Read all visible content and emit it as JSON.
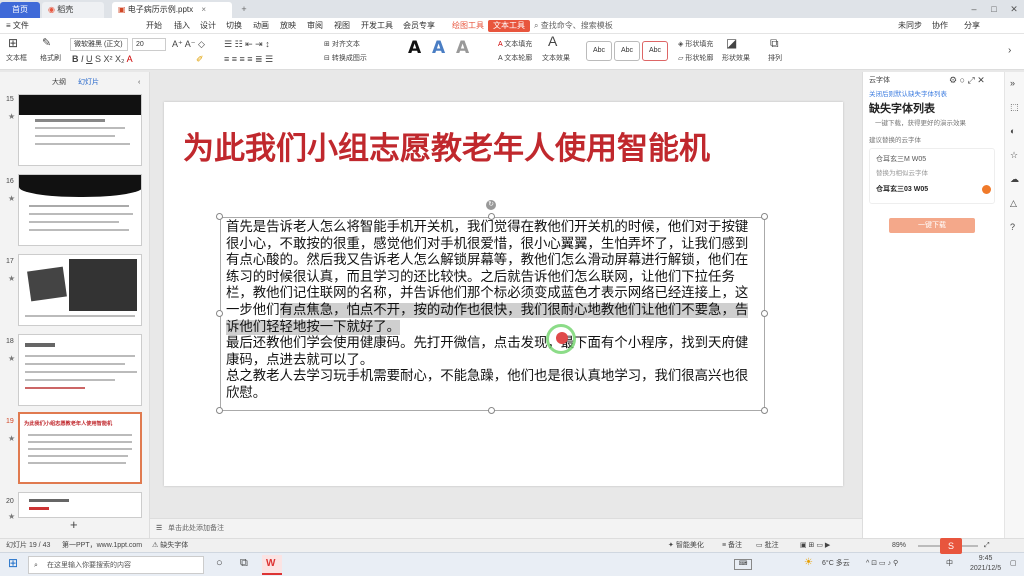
{
  "titlebar": {
    "tabs": [
      "首页",
      "稻壳",
      "电子病历示例.pptx"
    ]
  },
  "menu": {
    "items": [
      "文件",
      "开始",
      "插入",
      "设计",
      "切换",
      "动画",
      "放映",
      "审阅",
      "视图",
      "开发工具",
      "会员专享",
      "绘图工具",
      "文本工具"
    ],
    "search": "查找命令、搜索模板",
    "right": [
      "未同步",
      "协作",
      "分享"
    ]
  },
  "ribbon": {
    "textbox_label": "文本框",
    "clear_label": "格式刷",
    "font_name": "微软雅黑 (正文)",
    "font_size": "20",
    "align_label": "对齐文本",
    "convert_label": "转换成图示",
    "fill_label": "文本填充",
    "outline_label": "文本轮廓",
    "effect_label": "文本效果",
    "shape_fill": "形状填充",
    "shape_outline": "形状轮廓",
    "shape_effect": "形状效果",
    "style_boxes": [
      "Abc",
      "Abc",
      "Abc"
    ],
    "arrange": "排列"
  },
  "left_panel": {
    "tabs": [
      "大纲",
      "幻灯片"
    ],
    "slides": [
      {
        "num": "15",
        "star": "★"
      },
      {
        "num": "16",
        "star": "★"
      },
      {
        "num": "17",
        "star": "★"
      },
      {
        "num": "18",
        "star": "★"
      },
      {
        "num": "19",
        "star": "★",
        "title": "为此我们小组志愿教老年人使用智能机"
      },
      {
        "num": "20",
        "star": "★"
      }
    ],
    "add": "+"
  },
  "slide": {
    "title": "为此我们小组志愿教老年人使用智能机",
    "body_1": "首先是告诉老人怎么将智能手机开关机，我们觉得在教他们开关机的时候，他们对于按键很小心，不敢按的很重，感觉他们对手机很爱惜，很小心翼翼，生怕弄坏了，让我们感到有点心酸的。然后我又告诉老人怎么解锁屏幕等，教他们怎么滑动屏幕进行解锁，他们在练习的时候很认真，而且学习的还比较快。之后就告诉他们怎么联网，让他们下拉任务栏，教他们记住联网的名称，并告诉他们那个标必须变成蓝色才表示网络已经连接上，这一步他们",
    "body_hl": "有点焦急，怕点不开，按的动作也很快，我们很耐心地教他们让他们不要急，告诉他们轻轻地按一下就好了。",
    "body_2": "最后还教他们学会使用健康码。先打开微信，点击发现，最下面有个小程序，找到天府健康码，点进去就可以了。",
    "body_3": "总之教老人去学习玩手机需要耐心，不能急躁，他们也是很认真地学习，我们很高兴也很欣慰。"
  },
  "notes": {
    "placeholder": "单击此处添加备注"
  },
  "right_panel": {
    "header": "云字体",
    "link": "关闭后则默认缺失字体列表",
    "title": "缺失字体列表",
    "desc": "一键下载，获得更好的演示效果",
    "section": "建议替换的云字体",
    "font_1": "仓耳玄三M W05",
    "font_1_sub": "替换为相似云字体",
    "font_2": "仓耳玄三03 W05",
    "download": "一键下载"
  },
  "statusbar": {
    "slide": "幻灯片 19 / 43",
    "theme": "第一PPT，www.1ppt.com",
    "missing": "缺失字体",
    "beautify": "智能美化",
    "notes": "备注",
    "comments": "批注",
    "zoom": "89%"
  },
  "taskbar": {
    "search": "在这里输入你要搜索的内容",
    "weather": "6°C 多云",
    "time": "9:45",
    "date": "2021/12/5",
    "lang": "中"
  }
}
